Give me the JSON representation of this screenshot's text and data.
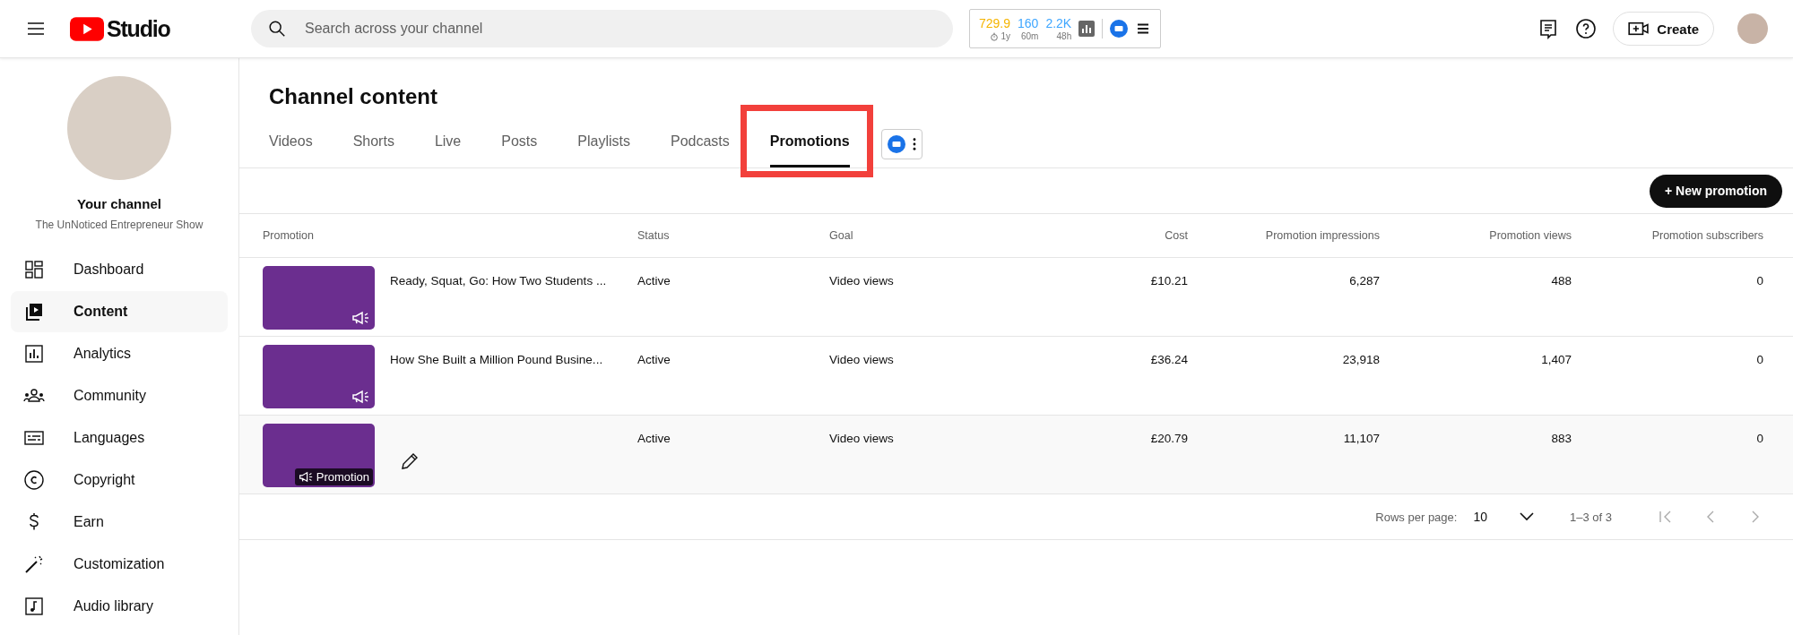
{
  "topbar": {
    "logo": "Studio",
    "search": {
      "placeholder": "Search across your channel"
    },
    "stats": [
      {
        "value": "729.9",
        "caption": "1y",
        "color": "#f5b400",
        "timer": true
      },
      {
        "value": "160",
        "caption": "60m",
        "color": "#3ea6ff",
        "timer": false
      },
      {
        "value": "2.2K",
        "caption": "48h",
        "color": "#3ea6ff",
        "timer": false
      }
    ],
    "create_label": "Create"
  },
  "sidebar": {
    "channel_title": "Your channel",
    "channel_name": "The UnNoticed Entrepreneur Show",
    "items": [
      {
        "label": "Dashboard",
        "selected": false
      },
      {
        "label": "Content",
        "selected": true
      },
      {
        "label": "Analytics",
        "selected": false
      },
      {
        "label": "Community",
        "selected": false
      },
      {
        "label": "Languages",
        "selected": false
      },
      {
        "label": "Copyright",
        "selected": false
      },
      {
        "label": "Earn",
        "selected": false
      },
      {
        "label": "Customization",
        "selected": false
      },
      {
        "label": "Audio library",
        "selected": false
      }
    ]
  },
  "page_title": "Channel content",
  "tabs": [
    {
      "label": "Videos",
      "selected": false,
      "highlighted": false
    },
    {
      "label": "Shorts",
      "selected": false,
      "highlighted": false
    },
    {
      "label": "Live",
      "selected": false,
      "highlighted": false
    },
    {
      "label": "Posts",
      "selected": false,
      "highlighted": false
    },
    {
      "label": "Playlists",
      "selected": false,
      "highlighted": false
    },
    {
      "label": "Podcasts",
      "selected": false,
      "highlighted": false
    },
    {
      "label": "Promotions",
      "selected": true,
      "highlighted": true
    }
  ],
  "new_button": "+ New promotion",
  "table": {
    "columns": [
      "Promotion",
      "Status",
      "Goal",
      "Cost",
      "Promotion impressions",
      "Promotion views",
      "Promotion subscribers"
    ],
    "rows": [
      {
        "title": "Ready, Squat, Go: How Two Students ...",
        "hovered": false,
        "status": "Active",
        "goal": "Video views",
        "cost": "£10.21",
        "impressions": "6,287",
        "views": "488",
        "subscribers": "0"
      },
      {
        "title": "How She Built a Million Pound Busine...",
        "hovered": false,
        "status": "Active",
        "goal": "Video views",
        "cost": "£36.24",
        "impressions": "23,918",
        "views": "1,407",
        "subscribers": "0"
      },
      {
        "badge": "Promotion",
        "hovered": true,
        "status": "Active",
        "goal": "Video views",
        "cost": "£20.79",
        "impressions": "11,107",
        "views": "883",
        "subscribers": "0"
      }
    ]
  },
  "pagination": {
    "rows_label": "Rows per page:",
    "rows_value": "10",
    "range": "1–3 of 3"
  }
}
